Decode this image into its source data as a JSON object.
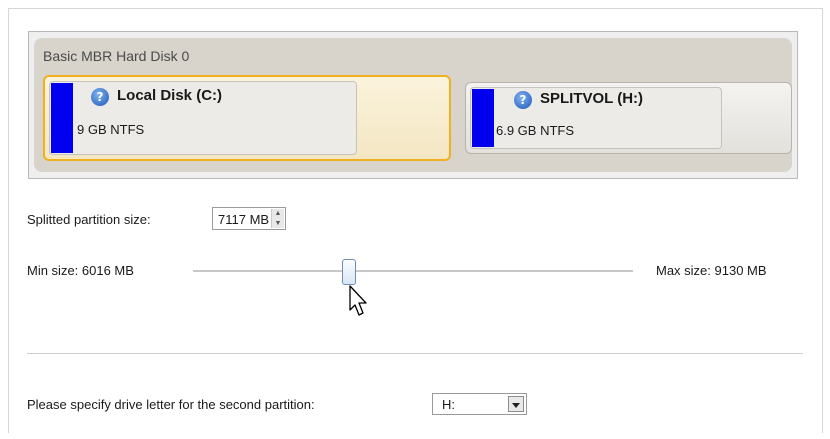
{
  "disk": {
    "title": "Basic MBR Hard Disk 0",
    "partitions": [
      {
        "name": "Local Disk (C:)",
        "size": "9 GB NTFS",
        "color": "#0000ee",
        "selected": true
      },
      {
        "name": "SPLITVOL (H:)",
        "size": "6.9 GB NTFS",
        "color": "#0000ee",
        "selected": false
      }
    ]
  },
  "split": {
    "size_label": "Splitted partition size:",
    "size_value": "7117 MB",
    "min_label": "Min size: 6016 MB",
    "max_label": "Max size: 9130 MB",
    "slider_level_mb": 7117,
    "min_mb": 6016,
    "max_mb": 9130
  },
  "drive_letter": {
    "label": "Please specify drive letter for the second partition:",
    "value": "H:"
  },
  "colors": {
    "partition": "#0000ee",
    "selection": "#f0b020"
  },
  "icons": {
    "partition_status": "question-icon",
    "cursor": "mouse-pointer-icon"
  }
}
